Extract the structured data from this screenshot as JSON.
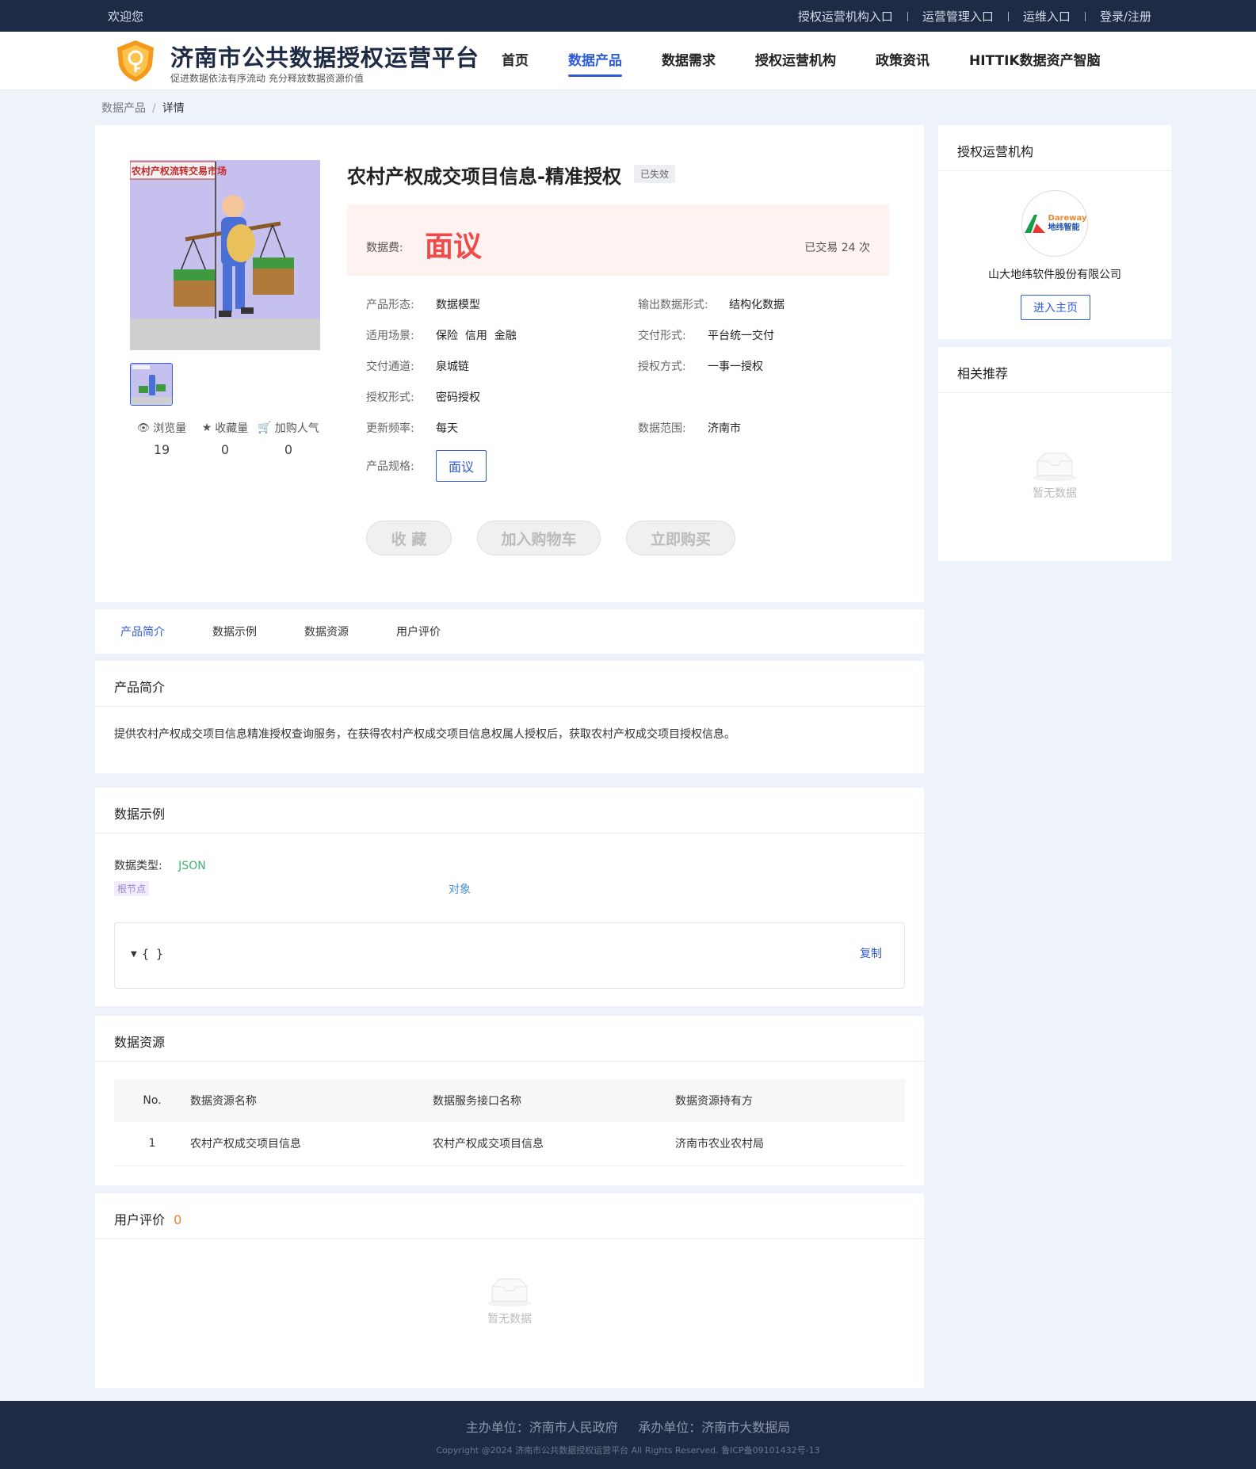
{
  "topbar": {
    "welcome": "欢迎您",
    "links": [
      "授权运营机构入口",
      "运营管理入口",
      "运维入口",
      "登录/注册"
    ]
  },
  "brand": {
    "title": "济南市公共数据授权运营平台",
    "subtitle": "促进数据依法有序流动 充分释放数据资源价值"
  },
  "nav": [
    "首页",
    "数据产品",
    "数据需求",
    "授权运营机构",
    "政策资讯",
    "HITTIK数据资产智脑"
  ],
  "breadcrumb": {
    "parent": "数据产品",
    "current": "详情"
  },
  "product": {
    "image_caption": "农村产权流转交易市场",
    "title": "农村产权成交项目信息-精准授权",
    "status": "已失效",
    "price_label": "数据费:",
    "price_value": "面议",
    "trades": "已交易 24 次",
    "stats": [
      {
        "label": "浏览量",
        "value": "19",
        "icon": "eye-icon"
      },
      {
        "label": "收藏量",
        "value": "0",
        "icon": "star-icon"
      },
      {
        "label": "加购人气",
        "value": "0",
        "icon": "cart-icon"
      }
    ],
    "attrs": {
      "form_k": "产品形态:",
      "form_v": "数据模型",
      "output_k": "输出数据形式:",
      "output_v": "结构化数据",
      "scene_k": "适用场景:",
      "scene_v": "保险  信用  金融",
      "delivery_k": "交付形式:",
      "delivery_v": "平台统一交付",
      "channel_k": "交付通道:",
      "channel_v": "泉城链",
      "authway_k": "授权方式:",
      "authway_v": "一事一授权",
      "authform_k": "授权形式:",
      "authform_v": "密码授权",
      "freq_k": "更新频率:",
      "freq_v": "每天",
      "range_k": "数据范围:",
      "range_v": "济南市",
      "spec_k": "产品规格:",
      "spec_v": "面议"
    },
    "buttons": {
      "fav": "收 藏",
      "cart": "加入购物车",
      "buy": "立即购买"
    }
  },
  "org": {
    "heading": "授权运营机构",
    "logo_text": "Dareway",
    "logo_text_cn": "地纬智能",
    "name": "山大地纬软件股份有限公司",
    "enter": "进入主页"
  },
  "related": {
    "heading": "相关推荐",
    "empty": "暂无数据"
  },
  "tabs": [
    "产品简介",
    "数据示例",
    "数据资源",
    "用户评价"
  ],
  "intro": {
    "heading": "产品简介",
    "text": "提供农村产权成交项目信息精准授权查询服务，在获得农村产权成交项目信息权属人授权后，获取农村产权成交项目授权信息。"
  },
  "example": {
    "heading": "数据示例",
    "type_label": "数据类型:",
    "type_value": "JSON",
    "root_tag": "根节点",
    "root_type": "对象",
    "code": "{ }",
    "copy": "复制"
  },
  "resources": {
    "heading": "数据资源",
    "columns": [
      "No.",
      "数据资源名称",
      "数据服务接口名称",
      "数据资源持有方"
    ],
    "rows": [
      [
        "1",
        "农村产权成交项目信息",
        "农村产权成交项目信息",
        "济南市农业农村局"
      ]
    ]
  },
  "reviews": {
    "heading": "用户评价",
    "count": "0",
    "empty": "暂无数据"
  },
  "footer": {
    "line1": "主办单位：济南市人民政府     承办单位：济南市大数据局",
    "line2": "Copyright @2024 济南市公共数据授权运营平台 All Rights Reserved. 鲁ICP备09101432号-13"
  },
  "colors": {
    "accent": "#2e5bd8",
    "dark": "#1f2a44",
    "price": "#f04a4a",
    "json": "#3cb371"
  }
}
